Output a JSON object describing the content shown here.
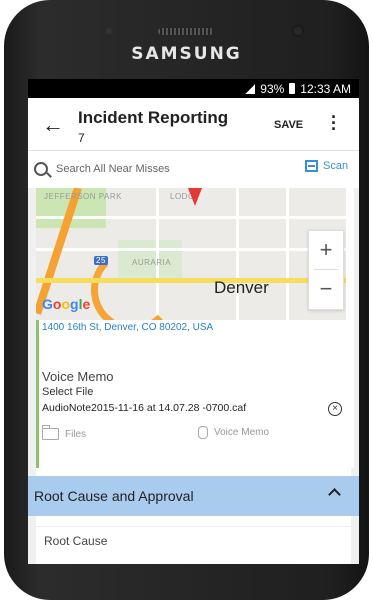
{
  "device": {
    "brand": "SAMSUNG"
  },
  "status": {
    "battery": "93%",
    "time": "12:33 AM"
  },
  "appbar": {
    "title": "Incident Reporting",
    "subtitle": "7",
    "save_label": "SAVE"
  },
  "search": {
    "placeholder": "Search All Near Misses",
    "scan_label": "Scan"
  },
  "map": {
    "city": "Denver",
    "google": "Google",
    "labels": [
      "JEFFERSON PARK",
      "AURARIA",
      "LODO",
      "25"
    ],
    "zoom_in": "+",
    "zoom_out": "−"
  },
  "location": {
    "address": "1400 16th St, Denver, CO 80202, USA"
  },
  "voice_memo": {
    "title": "Voice Memo",
    "select": "Select File",
    "file": "AudioNote2015-11-16 at 14.07.28 -0700.caf",
    "files_label": "Files",
    "memo_label": "Voice Memo"
  },
  "section": {
    "label": "Root Cause and Approval"
  },
  "root_cause": {
    "label": "Root Cause"
  }
}
